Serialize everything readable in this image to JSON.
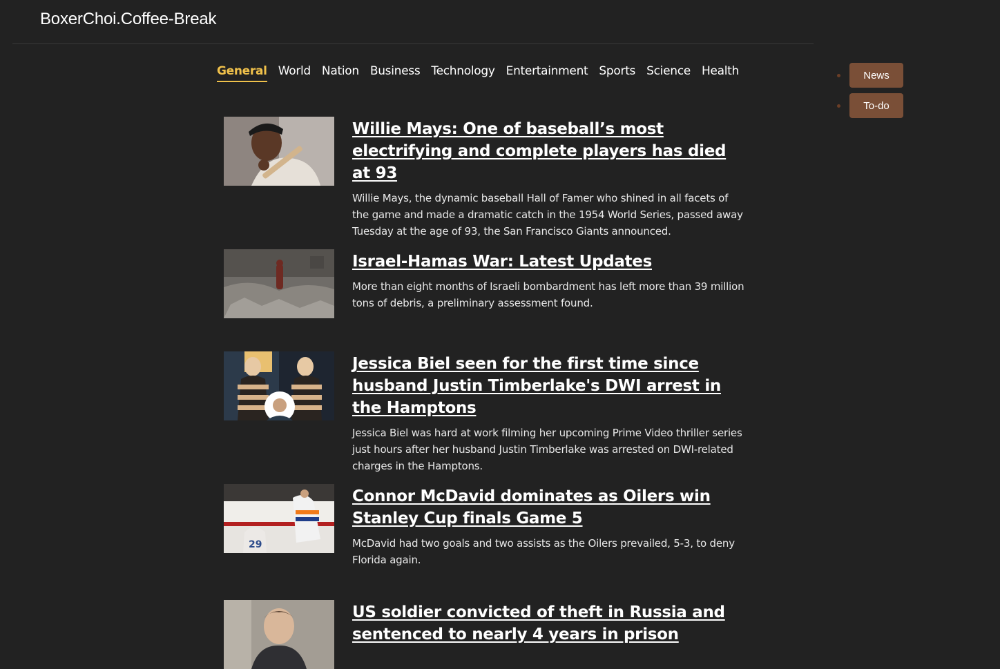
{
  "app": {
    "title": "BoxerChoi.Coffee-Break"
  },
  "nav": {
    "tabs": [
      "General",
      "World",
      "Nation",
      "Business",
      "Technology",
      "Entertainment",
      "Sports",
      "Science",
      "Health"
    ],
    "active": "General"
  },
  "side_menu": {
    "items": [
      "News",
      "To-do"
    ]
  },
  "articles": [
    {
      "title": "Willie Mays: One of baseball’s most electrifying and complete players has died at 93",
      "description": "Willie Mays, the dynamic baseball Hall of Famer who shined in all facets of the game and made a dramatic catch in the 1954 World Series, passed away Tuesday at the age of 93, the San Francisco Giants announced.",
      "image": "baseball-player-photo"
    },
    {
      "title": "Israel-Hamas War: Latest Updates",
      "description": "More than eight months of Israeli bombardment has left more than 39 million tons of debris, a preliminary assessment found.",
      "image": "rubble-photo"
    },
    {
      "title": "Jessica Biel seen for the first time since husband Justin Timberlake's DWI arrest in the Hamptons",
      "description": "Jessica Biel was hard at work filming her upcoming Prime Video thriller series just hours after her husband Justin Timberlake was arrested on DWI-related charges in the Hamptons.",
      "image": "celebrity-photo"
    },
    {
      "title": "Connor McDavid dominates as Oilers win Stanley Cup finals Game 5",
      "description": "McDavid had two goals and two assists as the Oilers prevailed, 5-3, to deny Florida again.",
      "image": "hockey-photo"
    },
    {
      "title": "US soldier convicted of theft in Russia and sentenced to nearly 4 years in prison",
      "description": "",
      "image": "soldier-photo"
    }
  ]
}
